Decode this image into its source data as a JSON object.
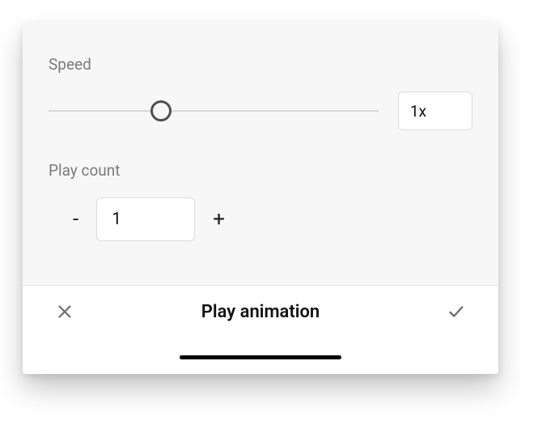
{
  "speed": {
    "label": "Speed",
    "value_text": "1x",
    "slider_position_percent": 34
  },
  "play_count": {
    "label": "Play count",
    "decrement_label": "-",
    "increment_label": "+",
    "value_text": "1"
  },
  "footer": {
    "title": "Play animation"
  },
  "icons": {
    "cancel": "close-icon",
    "confirm": "check-icon"
  }
}
